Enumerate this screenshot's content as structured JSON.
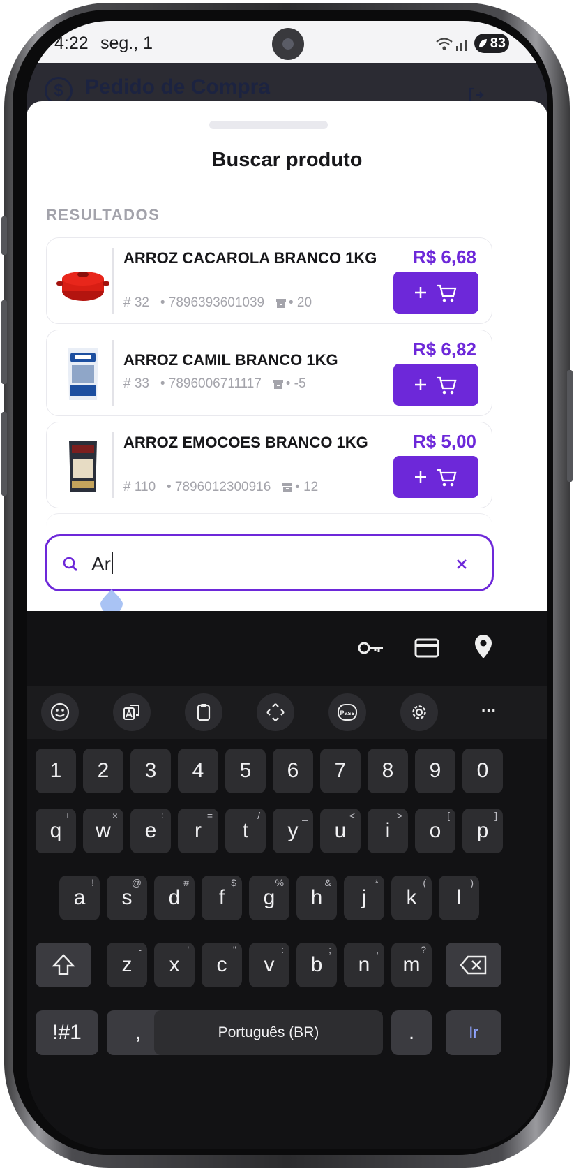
{
  "status_bar": {
    "time": "4:22",
    "date": "seg., 1",
    "battery": "83"
  },
  "app_header": {
    "logo": "$",
    "title": "Pedido de Compra"
  },
  "sheet": {
    "title": "Buscar produto",
    "section_label": "RESULTADOS"
  },
  "products": [
    {
      "name": "ARROZ CACAROLA BRANCO 1KG",
      "code": "# 32",
      "barcode": "• 7896393601039",
      "stock": "• 20",
      "price": "R$ 6,68",
      "image": "cacarola-pot",
      "stock_icon": "box-icon"
    },
    {
      "name": "ARROZ CAMIL BRANCO 1KG",
      "code": "# 33",
      "barcode": "• 7896006711117",
      "stock": "• -5",
      "price": "R$ 6,82",
      "image": "camil-bag",
      "stock_icon": "box-icon"
    },
    {
      "name": "ARROZ EMOCOES BRANCO 1KG",
      "code": "# 110",
      "barcode": "• 7896012300916",
      "stock": "• 12",
      "price": "R$ 5,00",
      "image": "emocoes-bag",
      "stock_icon": "box-icon"
    }
  ],
  "search": {
    "value": "Ar"
  },
  "keyboard": {
    "top_icons": [
      "key-icon",
      "card-icon",
      "location-icon"
    ],
    "tools": [
      "emoji-icon",
      "translate-icon",
      "clipboard-icon",
      "cursor-move-icon",
      "pass-icon",
      "settings-icon",
      "more-icon"
    ],
    "tool_pass_label": "Pass",
    "tool_more_label": "···",
    "numbers": [
      "1",
      "2",
      "3",
      "4",
      "5",
      "6",
      "7",
      "8",
      "9",
      "0"
    ],
    "row1": [
      {
        "k": "q",
        "h": "+"
      },
      {
        "k": "w",
        "h": "×"
      },
      {
        "k": "e",
        "h": "÷"
      },
      {
        "k": "r",
        "h": "="
      },
      {
        "k": "t",
        "h": "/"
      },
      {
        "k": "y",
        "h": "_"
      },
      {
        "k": "u",
        "h": "<"
      },
      {
        "k": "i",
        "h": ">"
      },
      {
        "k": "o",
        "h": "["
      },
      {
        "k": "p",
        "h": "]"
      }
    ],
    "row2": [
      {
        "k": "a",
        "h": "!"
      },
      {
        "k": "s",
        "h": "@"
      },
      {
        "k": "d",
        "h": "#"
      },
      {
        "k": "f",
        "h": "$"
      },
      {
        "k": "g",
        "h": "%"
      },
      {
        "k": "h",
        "h": "&"
      },
      {
        "k": "j",
        "h": "*"
      },
      {
        "k": "k",
        "h": "("
      },
      {
        "k": "l",
        "h": ")"
      }
    ],
    "row3": [
      {
        "k": "z",
        "h": "-"
      },
      {
        "k": "x",
        "h": "'"
      },
      {
        "k": "c",
        "h": "\""
      },
      {
        "k": "v",
        "h": ":"
      },
      {
        "k": "b",
        "h": ";"
      },
      {
        "k": "n",
        "h": ","
      },
      {
        "k": "m",
        "h": "?"
      }
    ],
    "symbols": "!#1",
    "comma": ",",
    "space": "Português (BR)",
    "period": ".",
    "suggestion": "Ir"
  },
  "colors": {
    "accent": "#6d28d9",
    "keyboard_bg": "#121214",
    "key_bg": "#2d2d30"
  }
}
